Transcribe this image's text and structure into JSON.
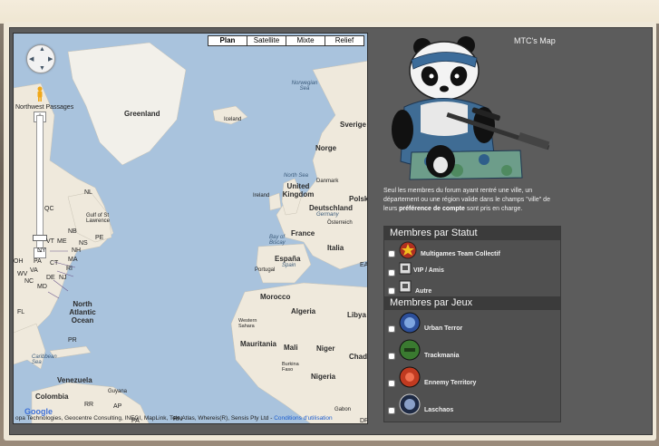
{
  "map": {
    "type_buttons": [
      "Plan",
      "Satellite",
      "Mixte",
      "Relief"
    ],
    "active_type": "Plan",
    "labels": {
      "greenland": "Greenland",
      "iceland": "Iceland",
      "norwegian_sea": "Norwegian Sea",
      "sverige": "Sverige",
      "norge": "Norge",
      "north_sea": "North Sea",
      "united_kingdom": "United Kingdom",
      "ireland": "Ireland",
      "danmark": "Danmark",
      "polska": "Polska",
      "deutschland": "Deutschland",
      "germany": "Germany",
      "osterreich": "Österreich",
      "france": "France",
      "bay_of_biscay": "Bay of Biscay",
      "italia": "Italia",
      "espana": "España",
      "spain": "Spain",
      "portugal": "Portugal",
      "morocco": "Morocco",
      "algeria": "Algeria",
      "libya": "Libya",
      "western_sahara": "Western Sahara",
      "mauritania": "Mauritania",
      "mali": "Mali",
      "niger": "Niger",
      "chad": "Chad",
      "burkina_faso": "Burkina Faso",
      "nigeria": "Nigeria",
      "gabon": "Gabon",
      "north_atlantic_ocean": "North Atlantic Ocean",
      "caribbean_sea": "Caribbean Sea",
      "venezuela": "Venezuela",
      "colombia": "Colombia",
      "guyana": "Guyana",
      "northwest_passages": "Northwest Passages",
      "nl": "NL",
      "qc": "QC",
      "gulf_st_lawrence": "Gulf of St Lawrence",
      "nb": "NB",
      "pe": "PE",
      "ns": "NS",
      "vt": "VT",
      "me": "ME",
      "ny": "NY",
      "nh": "NH",
      "ma": "MA",
      "ct": "CT",
      "ri": "RI",
      "oh": "OH",
      "pa": "PA",
      "wv": "WV",
      "va": "VA",
      "nj": "NJ",
      "de": "DE",
      "md": "MD",
      "nc": "NC",
      "fl": "FL",
      "pr": "PR",
      "ea": "EA",
      "rr": "RR",
      "rn": "RN",
      "ap": "AP",
      "pa2": "PA",
      "dr": "DR"
    },
    "attribution": "opa Technologies, Geocentre Consulting, INEGI, MapLink, Tele Atlas, Whereis(R), Sensis Pty Ltd -",
    "attribution_link": "Conditions d'utilisation",
    "logo": "Google"
  },
  "panel": {
    "title": "MTC's Map",
    "info_prefix": "Seul les membres du forum ayant rentré une ville, un département ou une région valide dans le champs \"ville\" de leurs",
    "info_bold": "préférence de compte",
    "info_suffix": "sont pris en charge."
  },
  "sections": [
    {
      "title": "Membres par Statut",
      "items": [
        {
          "label": "Multigames Team Collectif",
          "icon": "star-badge-icon"
        },
        {
          "label": "VIP / Amis",
          "icon": "vip-badge-icon"
        },
        {
          "label": "Autre",
          "icon": "member-badge-icon"
        }
      ]
    },
    {
      "title": "Membres par Jeux",
      "items": [
        {
          "label": "Urban Terror",
          "icon": "urban-terror-icon"
        },
        {
          "label": "Trackmania",
          "icon": "trackmania-icon"
        },
        {
          "label": "Ennemy Territory",
          "icon": "enemy-territory-icon"
        },
        {
          "label": "Laschaos",
          "icon": "laschaos-icon"
        }
      ]
    }
  ],
  "colors": {
    "panel_bg": "#5c5c5c",
    "section_header": "#3b3b3b",
    "ocean": "#a9c3dd",
    "land": "#efe9dc"
  }
}
